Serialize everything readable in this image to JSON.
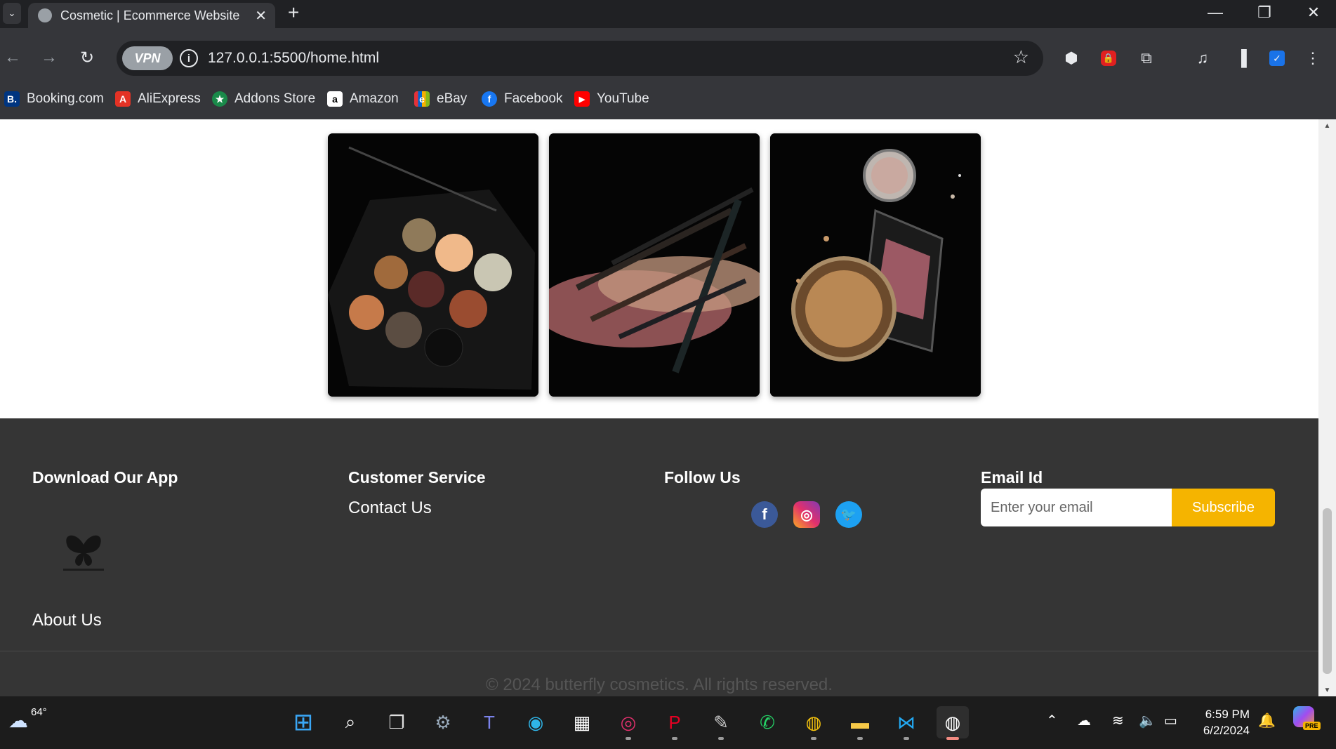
{
  "browser": {
    "tab_title": "Cosmetic | Ecommerce Website",
    "url": "127.0.0.1:5500/home.html",
    "vpn_label": "VPN",
    "bookmarks": [
      {
        "label": "Booking.com",
        "badge": "B.",
        "color": "#003580"
      },
      {
        "label": "AliExpress",
        "badge": "A",
        "color": "#e43225"
      },
      {
        "label": "Addons Store",
        "badge": "★",
        "color": "#1a8a4a"
      },
      {
        "label": "Amazon",
        "badge": "a",
        "color": "#ffffff"
      },
      {
        "label": "eBay",
        "badge": "e",
        "color": "#e53238"
      },
      {
        "label": "Facebook",
        "badge": "f",
        "color": "#1877f2"
      },
      {
        "label": "YouTube",
        "badge": "▶",
        "color": "#ff0000"
      }
    ]
  },
  "page": {
    "gallery": [
      {
        "subject": "eyeshadow palette"
      },
      {
        "subject": "eye pencils and powder"
      },
      {
        "subject": "compact blush and powder"
      }
    ],
    "footer": {
      "app_heading": "Download Our App",
      "about_label": "About Us",
      "service_heading": "Customer Service",
      "contact_label": "Contact Us",
      "follow_heading": "Follow Us",
      "email_heading": "Email Id",
      "email_placeholder": "Enter your email",
      "subscribe_label": "Subscribe",
      "copyright": "© 2024 butterfly cosmetics. All rights reserved."
    },
    "colors": {
      "footer_bg": "#353535",
      "accent": "#f5b400"
    }
  },
  "taskbar": {
    "temperature": "64°",
    "time": "6:59 PM",
    "date": "6/2/2024",
    "copilot_badge": "PRE"
  }
}
